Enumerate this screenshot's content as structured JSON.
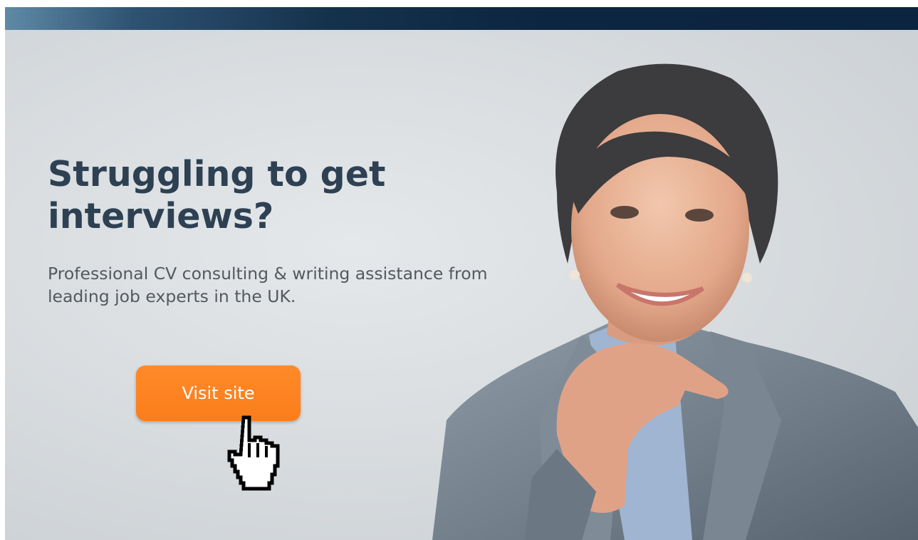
{
  "ad": {
    "headline": "Struggling to get interviews?",
    "subtext": "Professional CV consulting & writing assistance from leading job experts in the UK.",
    "cta_label": "Visit site"
  },
  "icons": {
    "pointer": "hand-pointer-icon"
  },
  "colors": {
    "topbar": "#0c2540",
    "headline": "#2d4153",
    "subtext": "#53595f",
    "cta": "#fb7d1b",
    "cta_text": "#ffffff"
  }
}
